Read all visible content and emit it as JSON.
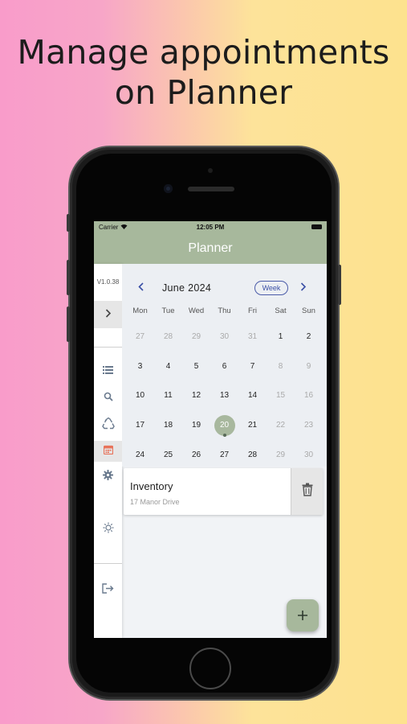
{
  "headline": "Manage appointments on Planner",
  "status": {
    "carrier": "Carrier",
    "time": "12:05 PM"
  },
  "nav": {
    "title": "Planner"
  },
  "sidebar": {
    "version": "V1.0.38",
    "icons": [
      "chevron-right-icon",
      "list-icon",
      "search-icon",
      "recycle-icon",
      "calendar-icon",
      "gear-icon",
      "sun-icon",
      "logout-icon"
    ],
    "active": "calendar-icon",
    "accent": "#e8735a"
  },
  "calendar": {
    "month_label": "June 2024",
    "view_button": "Week",
    "weekdays": [
      "Mon",
      "Tue",
      "Wed",
      "Thu",
      "Fri",
      "Sat",
      "Sun"
    ],
    "weeks": [
      [
        {
          "d": "27",
          "dim": true
        },
        {
          "d": "28",
          "dim": true
        },
        {
          "d": "29",
          "dim": true
        },
        {
          "d": "30",
          "dim": true
        },
        {
          "d": "31",
          "dim": true
        },
        {
          "d": "1"
        },
        {
          "d": "2"
        }
      ],
      [
        {
          "d": "3"
        },
        {
          "d": "4"
        },
        {
          "d": "5"
        },
        {
          "d": "6"
        },
        {
          "d": "7"
        },
        {
          "d": "8",
          "dim": true
        },
        {
          "d": "9",
          "dim": true
        }
      ],
      [
        {
          "d": "10"
        },
        {
          "d": "11"
        },
        {
          "d": "12"
        },
        {
          "d": "13"
        },
        {
          "d": "14"
        },
        {
          "d": "15",
          "dim": true
        },
        {
          "d": "16",
          "dim": true
        }
      ],
      [
        {
          "d": "17"
        },
        {
          "d": "18"
        },
        {
          "d": "19"
        },
        {
          "d": "20",
          "sel": true
        },
        {
          "d": "21"
        },
        {
          "d": "22",
          "dim": true
        },
        {
          "d": "23",
          "dim": true
        }
      ],
      [
        {
          "d": "24"
        },
        {
          "d": "25"
        },
        {
          "d": "26"
        },
        {
          "d": "27"
        },
        {
          "d": "28"
        },
        {
          "d": "29",
          "dim": true
        },
        {
          "d": "30",
          "dim": true
        }
      ]
    ]
  },
  "appointment": {
    "title": "Inventory",
    "address": "17 Manor Drive"
  },
  "colors": {
    "brand": "#a7b89c",
    "accent_blue": "#3a4fa6"
  }
}
